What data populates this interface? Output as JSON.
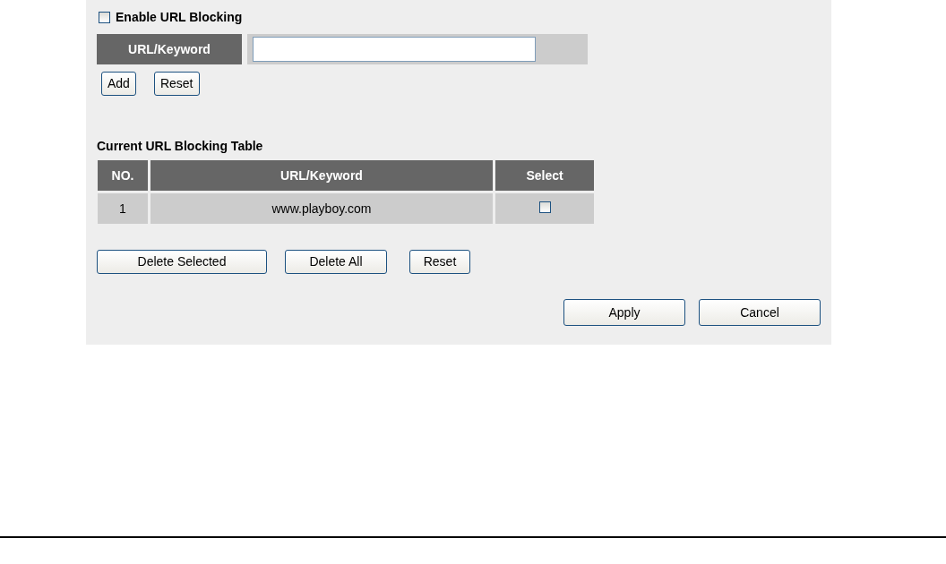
{
  "enable": {
    "label": "Enable URL Blocking",
    "checked": false
  },
  "url_entry": {
    "label": "URL/Keyword"
  },
  "entry_buttons": [
    "Add",
    "Reset"
  ],
  "table": {
    "title": "Current URL Blocking Table",
    "columns": [
      "NO.",
      "URL/Keyword",
      "Select"
    ],
    "rows": [
      {
        "no": "1",
        "url": "www.playboy.com",
        "checked": false
      }
    ]
  },
  "table_buttons": [
    "Delete Selected",
    "Delete All",
    "Reset"
  ],
  "footer_buttons": [
    "Apply",
    "Cancel"
  ]
}
